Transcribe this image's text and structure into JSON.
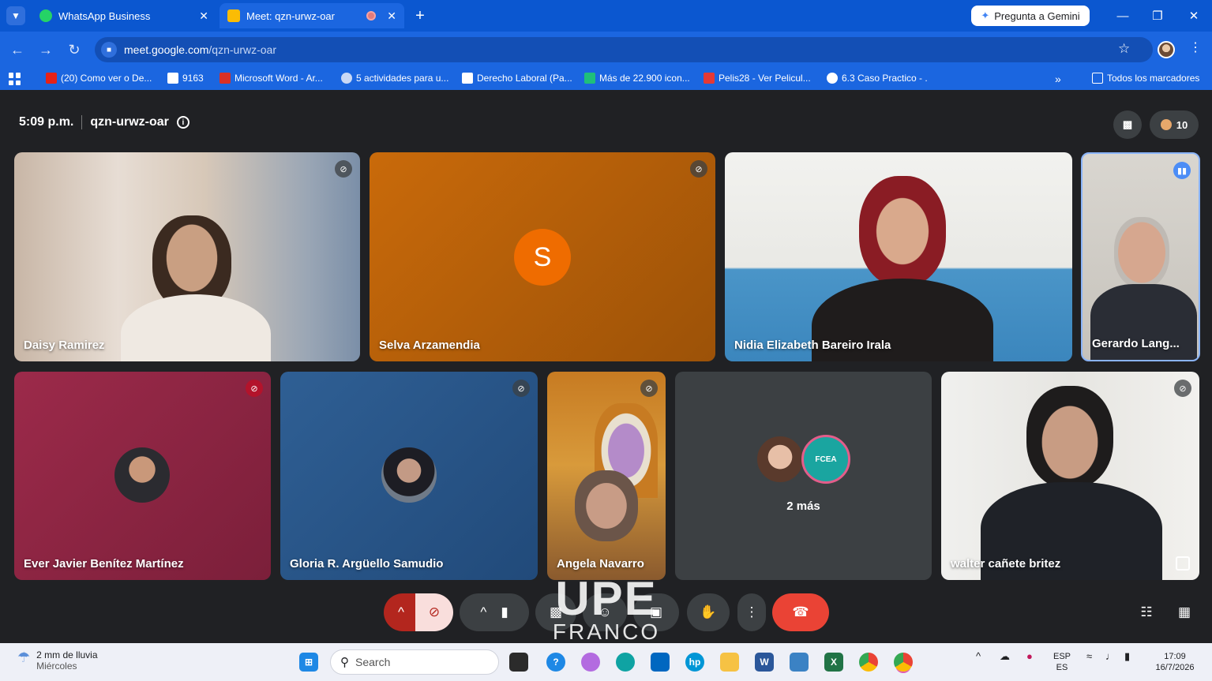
{
  "browser": {
    "tabs": [
      {
        "label": "WhatsApp Business",
        "icon": "whatsapp-icon",
        "active": false
      },
      {
        "label": "Meet: qzn-urwz-oar",
        "icon": "meet-icon",
        "active": true
      }
    ],
    "gemini_button": "Pregunta a Gemini",
    "url_host": "meet.google.com",
    "url_path": "/qzn-urwz-oar",
    "bookmarks": [
      {
        "label": "(20) Como ver o De...",
        "color": "#e62117"
      },
      {
        "label": "9163",
        "color": "#ffffff"
      },
      {
        "label": "Microsoft Word - Ar...",
        "color": "#d93025"
      },
      {
        "label": "5 actividades para u...",
        "color": "#c9d8f5"
      },
      {
        "label": "Derecho Laboral (Pa...",
        "color": "#ffffff"
      },
      {
        "label": "Más de 22.900 icon...",
        "color": "#1fbf7a"
      },
      {
        "label": "Pelis28 - Ver Pelicul...",
        "color": "#e53935"
      },
      {
        "label": "6.3 Caso Practico - .",
        "color": "#ffffff"
      }
    ],
    "all_bookmarks": "Todos los marcadores",
    "accent": "#0b57d0"
  },
  "meet": {
    "time": "5:09 p.m.",
    "code": "qzn-urwz-oar",
    "participant_count": "10",
    "participants": [
      {
        "name": "Daisy Ramirez",
        "muted": true
      },
      {
        "name": "Selva Arzamendia",
        "initial": "S",
        "muted": true
      },
      {
        "name": "Nidia Elizabeth Bareiro Irala",
        "muted": false
      },
      {
        "name": "Gerardo Lang...",
        "speaking": true
      },
      {
        "name": "Ever Javier Benítez Martínez",
        "muted": true
      },
      {
        "name": "Gloria R. Argüello Samudio",
        "muted": true
      },
      {
        "name": "Angela Navarro",
        "muted": true
      },
      {
        "name": "walter cañete britez",
        "muted": true
      }
    ],
    "more_label": "2 más",
    "more_badge": "FCEA",
    "watermark_top": "UPE",
    "watermark_bottom": "FRANCO"
  },
  "taskbar": {
    "weather_main": "2 mm de lluvia",
    "weather_sub": "Miércoles",
    "search_placeholder": "Search",
    "lang_top": "ESP",
    "lang_bottom": "ES",
    "time": "17:09",
    "date": "16/7/2026"
  }
}
